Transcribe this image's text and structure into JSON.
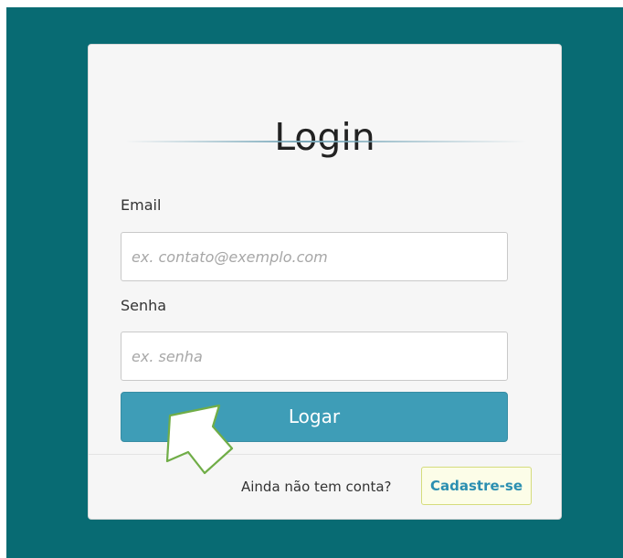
{
  "login": {
    "title": "Login",
    "email_label": "Email",
    "email_placeholder": "ex. contato@exemplo.com",
    "password_label": "Senha",
    "password_placeholder": "ex. senha",
    "submit_label": "Logar",
    "signup_prompt": "Ainda não tem conta?",
    "signup_label": "Cadastre-se"
  },
  "colors": {
    "background": "#086b73",
    "card": "#f6f6f6",
    "button": "#3e9db7",
    "signup_text": "#2b8fb1",
    "signup_border": "#d5dc7c",
    "pointer_outline": "#70ad47"
  },
  "icons": {
    "pointer": "up-left-arrow-icon"
  }
}
